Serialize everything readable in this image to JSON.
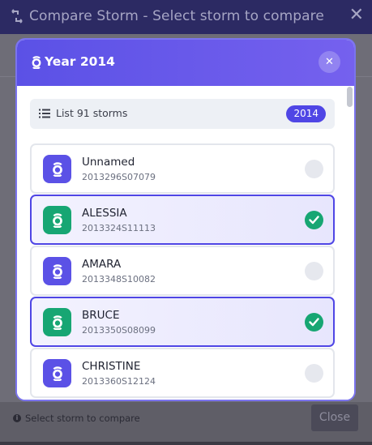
{
  "outer_modal": {
    "title": "Compare Storm - Select storm to compare",
    "status_text": "Select storm to compare",
    "close_label": "Close"
  },
  "dialog": {
    "title": "Year 2014",
    "info_text": "List 91 storms",
    "year_badge": "2014",
    "close_icon": "close-icon"
  },
  "storms": [
    {
      "name": "Unnamed",
      "id": "2013296S07079",
      "selected": false
    },
    {
      "name": "ALESSIA",
      "id": "2013324S11113",
      "selected": true
    },
    {
      "name": "AMARA",
      "id": "2013348S10082",
      "selected": false
    },
    {
      "name": "BRUCE",
      "id": "2013350S08099",
      "selected": true
    },
    {
      "name": "CHRISTINE",
      "id": "2013360S12124",
      "selected": false
    }
  ],
  "colors": {
    "accent": "#4f46e5",
    "selected": "#17a673",
    "header_gradient_start": "#5b51e6",
    "header_gradient_end": "#7561ee"
  }
}
